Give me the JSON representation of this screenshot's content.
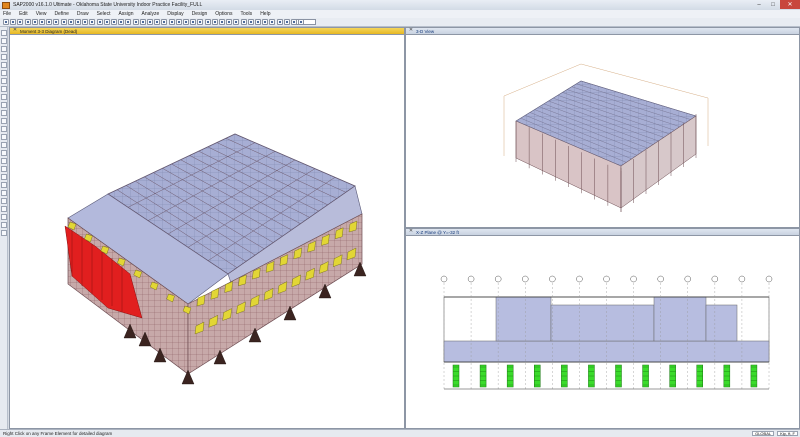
{
  "window": {
    "title": "SAP2000 v16.1.0 Ultimate - Oklahoma State University Indoor Practice Facility_FULL"
  },
  "menu": {
    "items": [
      "File",
      "Edit",
      "View",
      "Define",
      "Draw",
      "Select",
      "Assign",
      "Analyze",
      "Display",
      "Design",
      "Options",
      "Tools",
      "Help"
    ]
  },
  "panels": {
    "main": {
      "title": "Moment 3-3 Diagram (Dead)"
    },
    "top_right": {
      "title": "3-D View"
    },
    "bottom_right": {
      "title": "X-Z Plane @ Y=-32 ft"
    }
  },
  "status": {
    "text": "Right Click on any Frame Element for detailed diagram",
    "units": "GLOBAL",
    "unit_system": "Kip, ft, F"
  },
  "colors": {
    "deck_fill": "#a7aed4",
    "member_line": "#6d4d52",
    "moment_red": "#e11f1f",
    "moment_yellow": "#e2d635",
    "moment_dark": "#3b2420",
    "elevation_green": "#3adb2b"
  },
  "icons": {
    "close": "close-icon",
    "minimize": "minimize-icon",
    "maximize": "maximize-icon",
    "app": "sap2000-app-icon"
  }
}
